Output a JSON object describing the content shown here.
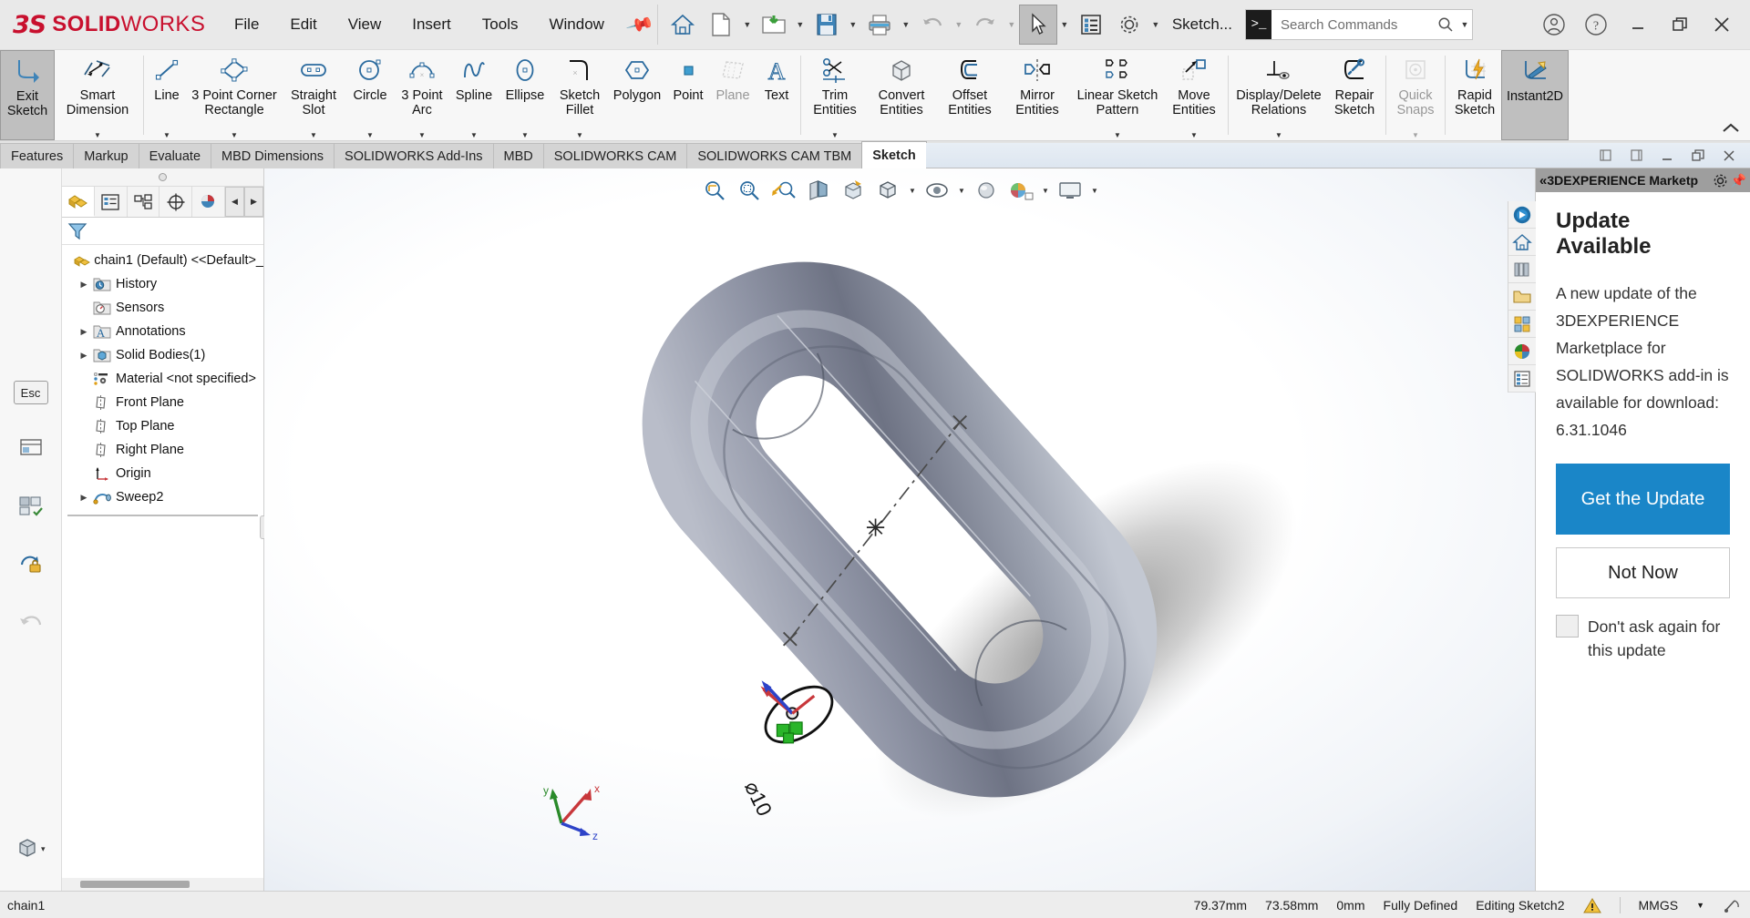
{
  "titlebar": {
    "brand_ds": "3S",
    "brand_solid": "SOLID",
    "brand_works": "WORKS",
    "menus": [
      "File",
      "Edit",
      "View",
      "Insert",
      "Tools",
      "Window"
    ],
    "pin_icon": "pin-icon",
    "quick_access": [
      {
        "name": "home-icon",
        "label": "Home"
      },
      {
        "name": "new-document-icon",
        "label": "New"
      },
      {
        "name": "open-folder-icon",
        "label": "Open"
      },
      {
        "name": "save-icon",
        "label": "Save"
      },
      {
        "name": "print-icon",
        "label": "Print"
      },
      {
        "name": "undo-icon",
        "label": "Undo"
      },
      {
        "name": "redo-icon",
        "label": "Redo"
      },
      {
        "name": "select-cursor-icon",
        "label": "Select"
      },
      {
        "name": "display-list-icon",
        "label": "Options List"
      },
      {
        "name": "gear-icon",
        "label": "Options"
      }
    ],
    "sketch_dropdown": "Sketch...",
    "search_placeholder": "Search Commands",
    "window_buttons": [
      "minimize",
      "restore",
      "close"
    ],
    "accent_red": "#c8102e"
  },
  "ribbon": {
    "groups": [
      {
        "items": [
          {
            "id": "exit-sketch",
            "label": "Exit\nSketch",
            "icon": "exit-sketch-icon",
            "selected": true,
            "dropdown": true
          },
          {
            "id": "smart-dimension",
            "label": "Smart\nDimension",
            "icon": "smart-dimension-icon",
            "dropdown": true
          }
        ]
      },
      {
        "items": [
          {
            "id": "line",
            "label": "Line",
            "icon": "line-icon",
            "dropdown": true
          },
          {
            "id": "corner-rectangle",
            "label": "3 Point Corner\nRectangle",
            "icon": "rectangle-icon",
            "dropdown": true
          },
          {
            "id": "straight-slot",
            "label": "Straight\nSlot",
            "icon": "slot-icon",
            "dropdown": true
          },
          {
            "id": "circle",
            "label": "Circle",
            "icon": "circle-icon",
            "dropdown": true
          },
          {
            "id": "3-point-arc",
            "label": "3 Point\nArc",
            "icon": "arc-icon",
            "dropdown": true
          },
          {
            "id": "spline",
            "label": "Spline",
            "icon": "spline-icon",
            "dropdown": true
          },
          {
            "id": "ellipse",
            "label": "Ellipse",
            "icon": "ellipse-icon",
            "dropdown": true
          },
          {
            "id": "sketch-fillet",
            "label": "Sketch\nFillet",
            "icon": "sketch-fillet-icon",
            "dropdown": true
          },
          {
            "id": "polygon",
            "label": "Polygon",
            "icon": "polygon-icon"
          },
          {
            "id": "point",
            "label": "Point",
            "icon": "point-icon"
          },
          {
            "id": "plane",
            "label": "Plane",
            "icon": "plane-icon",
            "disabled": true
          },
          {
            "id": "text",
            "label": "Text",
            "icon": "text-icon"
          }
        ]
      },
      {
        "items": [
          {
            "id": "trim-entities",
            "label": "Trim\nEntities",
            "icon": "trim-entities-icon",
            "dropdown": true
          },
          {
            "id": "convert-entities",
            "label": "Convert\nEntities",
            "icon": "convert-entities-icon"
          },
          {
            "id": "offset-entities",
            "label": "Offset\nEntities",
            "icon": "offset-entities-icon"
          },
          {
            "id": "mirror-entities",
            "label": "Mirror\nEntities",
            "icon": "mirror-entities-icon"
          },
          {
            "id": "linear-sketch-pattern",
            "label": "Linear Sketch\nPattern",
            "icon": "linear-pattern-icon",
            "dropdown": true
          },
          {
            "id": "move-entities",
            "label": "Move\nEntities",
            "icon": "move-entities-icon",
            "dropdown": true
          }
        ]
      },
      {
        "items": [
          {
            "id": "display-delete-relations",
            "label": "Display/Delete\nRelations",
            "icon": "display-delete-relations-icon",
            "dropdown": true
          },
          {
            "id": "repair-sketch",
            "label": "Repair\nSketch",
            "icon": "repair-sketch-icon"
          }
        ]
      },
      {
        "items": [
          {
            "id": "quick-snaps",
            "label": "Quick\nSnaps",
            "icon": "quick-snaps-icon",
            "disabled": true,
            "dropdown": true
          }
        ]
      },
      {
        "items": [
          {
            "id": "rapid-sketch",
            "label": "Rapid\nSketch",
            "icon": "rapid-sketch-icon"
          },
          {
            "id": "instant2d",
            "label": "Instant2D",
            "icon": "instant2d-icon",
            "selected": true
          }
        ]
      }
    ],
    "collapse_icon": "chevron-up-icon"
  },
  "tabs": {
    "items": [
      {
        "label": "Features",
        "active": false
      },
      {
        "label": "Markup",
        "active": false
      },
      {
        "label": "Evaluate",
        "active": false
      },
      {
        "label": "MBD Dimensions",
        "active": false
      },
      {
        "label": "SOLIDWORKS Add-Ins",
        "active": false
      },
      {
        "label": "MBD",
        "active": false
      },
      {
        "label": "SOLIDWORKS CAM",
        "active": false
      },
      {
        "label": "SOLIDWORKS CAM TBM",
        "active": false
      },
      {
        "label": "Sketch",
        "active": true
      }
    ],
    "window_controls": [
      "prev-pane",
      "next-pane",
      "minimize-doc",
      "restore-doc",
      "close-doc"
    ]
  },
  "left_rail": {
    "items": [
      {
        "name": "esc-key",
        "label": "Esc"
      },
      {
        "name": "filter-panel-icon",
        "label": ""
      },
      {
        "name": "hide-show-icon",
        "label": ""
      },
      {
        "name": "lock-rotation-icon",
        "label": ""
      },
      {
        "name": "undo-view-icon",
        "label": ""
      },
      {
        "name": "appearance-box-icon",
        "label": ""
      }
    ]
  },
  "tree": {
    "tabs": [
      {
        "name": "feature-manager-tab",
        "active": true
      },
      {
        "name": "property-manager-tab",
        "active": false
      },
      {
        "name": "configuration-manager-tab",
        "active": false
      },
      {
        "name": "dimxpert-manager-tab",
        "active": false
      },
      {
        "name": "display-manager-tab",
        "active": false
      }
    ],
    "filter_icon": "filter-icon",
    "items": [
      {
        "label": "chain1 (Default) <<Default>_",
        "icon": "part-icon",
        "arrow": false,
        "indent": 0
      },
      {
        "label": "History",
        "icon": "history-folder-icon",
        "arrow": true,
        "indent": 1
      },
      {
        "label": "Sensors",
        "icon": "sensors-folder-icon",
        "arrow": false,
        "indent": 1
      },
      {
        "label": "Annotations",
        "icon": "annotations-folder-icon",
        "arrow": true,
        "indent": 1
      },
      {
        "label": "Solid Bodies(1)",
        "icon": "solid-bodies-folder-icon",
        "arrow": true,
        "indent": 1
      },
      {
        "label": "Material <not specified>",
        "icon": "material-icon",
        "arrow": false,
        "indent": 1
      },
      {
        "label": "Front Plane",
        "icon": "plane-tree-icon",
        "arrow": false,
        "indent": 1
      },
      {
        "label": "Top Plane",
        "icon": "plane-tree-icon",
        "arrow": false,
        "indent": 1
      },
      {
        "label": "Right Plane",
        "icon": "plane-tree-icon",
        "arrow": false,
        "indent": 1
      },
      {
        "label": "Origin",
        "icon": "origin-icon",
        "arrow": false,
        "indent": 1
      },
      {
        "label": "Sweep2",
        "icon": "sweep-icon",
        "arrow": true,
        "indent": 1
      }
    ]
  },
  "viewport": {
    "toolbar": [
      {
        "name": "zoom-to-fit-icon"
      },
      {
        "name": "zoom-area-icon"
      },
      {
        "name": "previous-view-icon"
      },
      {
        "name": "section-view-icon"
      },
      {
        "name": "view-orientation-icon"
      },
      {
        "name": "display-style-icon",
        "dropdown": true
      },
      {
        "name": "hide-show-items-icon",
        "dropdown": true
      },
      {
        "name": "view-settings-icon",
        "dropdown": true
      },
      {
        "name": "apply-scene-icon",
        "dropdown": true
      },
      {
        "name": "view-setting-display-icon",
        "dropdown": true
      }
    ],
    "right_icons": [
      {
        "name": "3dexperience-icon"
      },
      {
        "name": "home-icon"
      },
      {
        "name": "library-icon"
      },
      {
        "name": "file-explorer-icon"
      },
      {
        "name": "design-library-icon"
      },
      {
        "name": "appearances-icon"
      },
      {
        "name": "custom-properties-icon"
      }
    ],
    "triad_labels": {
      "x": "x",
      "y": "y",
      "z": "z"
    },
    "model_name": "chain sweep model"
  },
  "right_panel": {
    "header_title": "3DEXPERIENCE Marketp",
    "header_collapse_icon": "chevron-left-icon",
    "header_gear_icon": "gear-icon",
    "header_pin_icon": "pin-icon",
    "heading": "Update Available",
    "body_text": "A new update of the 3DEXPERIENCE Marketplace for SOLIDWORKS add-in is available for download: 6.31.1046",
    "primary_button": "Get the Update",
    "secondary_button": "Not Now",
    "checkbox_label": "Don't ask again for this update",
    "checkbox_checked": false,
    "accent_blue": "#1a86c8"
  },
  "statusbar": {
    "document_name": "chain1",
    "coord_x": "79.37mm",
    "coord_y": "73.58mm",
    "coord_z": "0mm",
    "state": "Fully Defined",
    "editing": "Editing Sketch2",
    "warning_icon": "warning-icon",
    "units": "MMGS",
    "units_caret": "caret-down-icon",
    "tune_icon": "tune-icon"
  }
}
